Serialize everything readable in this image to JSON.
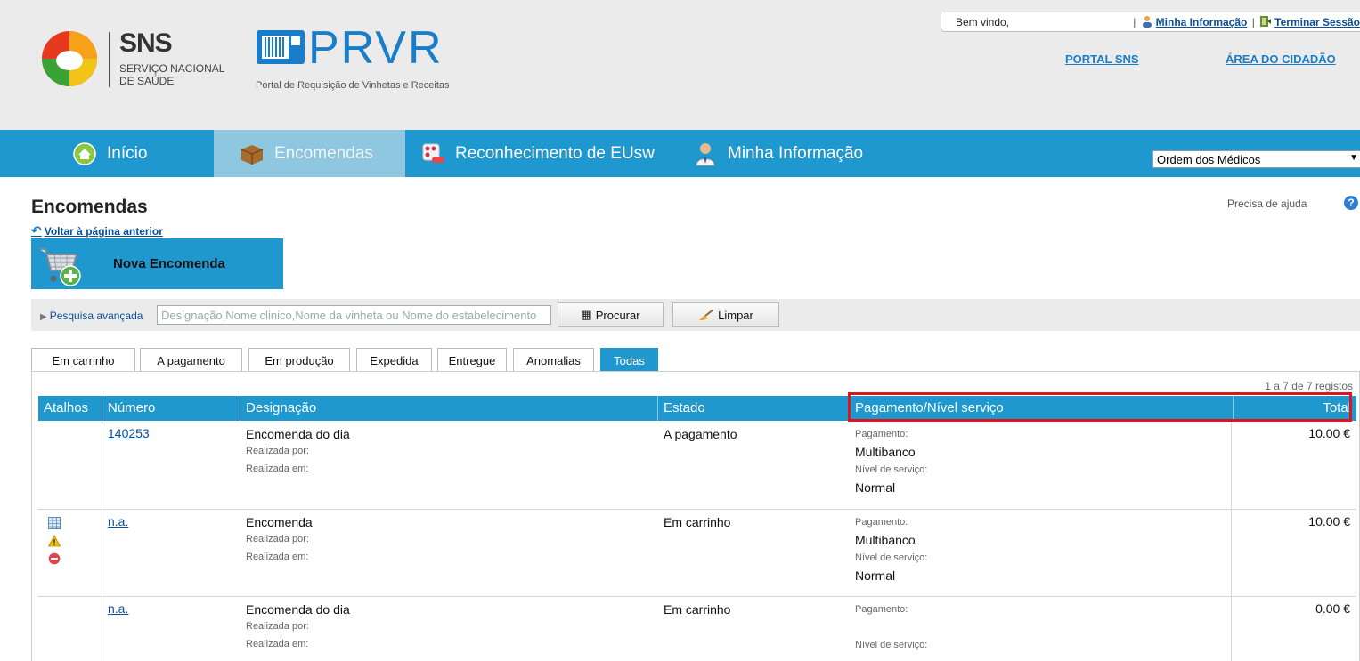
{
  "header": {
    "welcome": "Bem vindo,",
    "my_info_link": "Minha Informação",
    "logout_link": "Terminar Sessão",
    "portal_sns": "PORTAL SNS",
    "citizen_area": "ÁREA DO CIDADÃO",
    "sns_title": "SNS",
    "sns_subtitle_1": "SERVIÇO NACIONAL",
    "sns_subtitle_2": "DE SAÚDE",
    "prvr_title": "PRVR",
    "prvr_subtitle": "Portal de Requisição de Vinhetas e Receitas"
  },
  "nav": {
    "items": [
      {
        "label": "Início",
        "icon": "home-icon"
      },
      {
        "label": "Encomendas",
        "icon": "box-icon"
      },
      {
        "label": "Reconhecimento de EUsw",
        "icon": "pills-icon"
      },
      {
        "label": "Minha Informação",
        "icon": "doctor-icon"
      }
    ],
    "active": "Encomendas",
    "organization_select": "Ordem dos Médicos"
  },
  "main": {
    "title": "Encomendas",
    "back_link": "Voltar à página anterior",
    "help_text": "Precisa de ajuda",
    "new_order_label": "Nova Encomenda",
    "search": {
      "advanced_label": "Pesquisa avançada",
      "placeholder": "Designação,Nome clinico,Nome da vinheta ou Nome do estabelecimento",
      "search_button": "Procurar",
      "clear_button": "Limpar"
    },
    "tabs": [
      "Em carrinho",
      "A pagamento",
      "Em produção",
      "Expedida",
      "Entregue",
      "Anomalias",
      "Todas"
    ],
    "active_tab": "Todas",
    "record_count": "1 a 7 de 7 registos",
    "columns": [
      "Atalhos",
      "Número",
      "Designação",
      "Estado",
      "Pagamento/Nível serviço",
      "Total"
    ],
    "labels": {
      "made_by": "Realizada por:",
      "made_on": "Realizada em:",
      "payment": "Pagamento:",
      "service_level": "Nível de serviço:"
    },
    "rows": [
      {
        "number": "140253",
        "designation": "Encomenda do dia",
        "state": "A pagamento",
        "payment": "Multibanco",
        "service_level": "Normal",
        "total": "10.00 €"
      },
      {
        "number": "n.a.",
        "designation": "Encomenda",
        "state": "Em carrinho",
        "payment": "Multibanco",
        "service_level": "Normal",
        "total": "10.00 €",
        "shortcuts": [
          "table-icon",
          "warning-icon",
          "remove-icon"
        ]
      },
      {
        "number": "n.a.",
        "designation": "Encomenda do dia",
        "state": "Em carrinho",
        "payment": "",
        "service_level": "",
        "total": "0.00 €"
      }
    ]
  },
  "colors": {
    "accent": "#1f97cf",
    "highlight": "#e0141b",
    "header_bg": "#ebebeb"
  }
}
